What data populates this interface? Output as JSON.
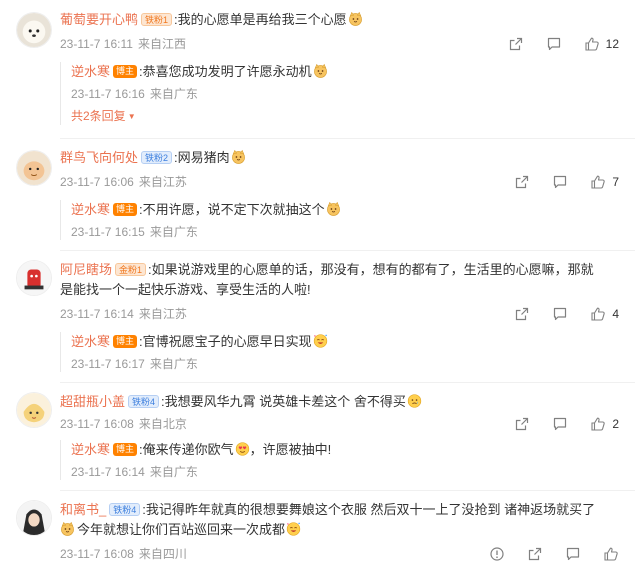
{
  "icons": {
    "share": "share-icon",
    "comment": "comment-icon",
    "like": "thumbs-up-icon"
  },
  "colors": {
    "username": "#eb7350",
    "meta": "#999999",
    "owner_badge": "#ff8200"
  },
  "comments": [
    {
      "user": "葡萄要开心鸭",
      "badge": "铁粉1",
      "text": ":我的心愿单是再给我三个心愿",
      "time": "23-11-7 16:11",
      "location": "来自江西",
      "likes": "12",
      "reply": {
        "user": "逆水寒",
        "badge": "博主",
        "text": ":恭喜您成功发明了许愿永动机",
        "time": "23-11-7 16:16",
        "location": "来自广东"
      },
      "more": "共2条回复"
    },
    {
      "user": "群鸟飞向何处",
      "badge": "铁粉2",
      "text": ":网易猪肉",
      "time": "23-11-7 16:06",
      "location": "来自江苏",
      "likes": "7",
      "reply": {
        "user": "逆水寒",
        "badge": "博主",
        "text": ":不用许愿，说不定下次就抽这个",
        "time": "23-11-7 16:15",
        "location": "来自广东"
      }
    },
    {
      "user": "阿尼瞎场",
      "badge": "金粉1",
      "text_line1": ":如果说游戏里的心愿单的话，那没有，想有的都有了，生活里的心愿嘛，那就",
      "text_line2": "是能找一个一起快乐游戏、享受生活的人啦!",
      "time": "23-11-7 16:14",
      "location": "来自江苏",
      "likes": "4",
      "reply": {
        "user": "逆水寒",
        "badge": "博主",
        "text": ":官博祝愿宝子的心愿早日实现",
        "time": "23-11-7 16:17",
        "location": "来自广东"
      }
    },
    {
      "user": "超甜瓶小盖",
      "badge": "铁粉4",
      "text": ":我想要风华九霄 说英雄卡差这个 舍不得买",
      "time": "23-11-7 16:08",
      "location": "来自北京",
      "likes": "2",
      "reply": {
        "user": "逆水寒",
        "badge": "博主",
        "text_a": ":俺来传递你欧气",
        "text_b": "，许愿被抽中!",
        "time": "23-11-7 16:14",
        "location": "来自广东"
      }
    },
    {
      "user": "和离书_",
      "badge": "铁粉4",
      "text_line1": ":我记得昨年就真的很想要舞娘这个衣服 然后双十一上了没抢到 诸神返场就买了",
      "text_line2": "今年就想让你们百站巡回来一次成都",
      "time": "23-11-7 16:08",
      "location": "来自四川"
    }
  ]
}
